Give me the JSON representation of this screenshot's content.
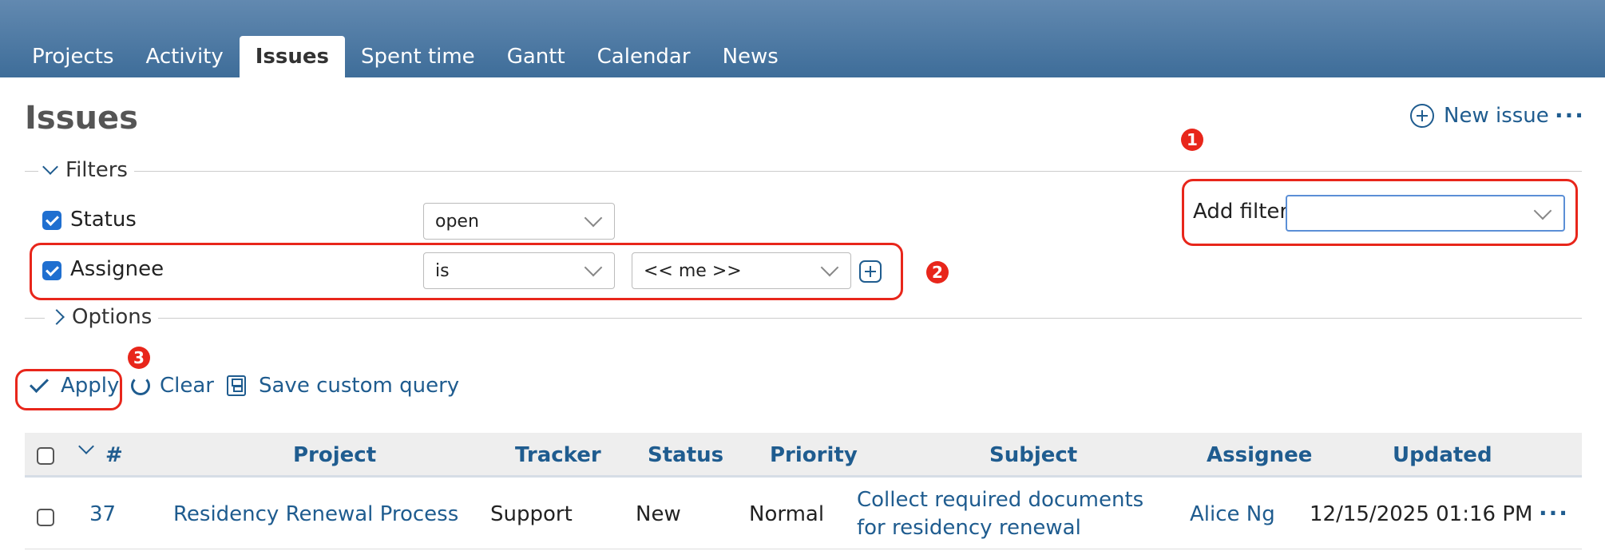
{
  "nav": {
    "tabs": [
      {
        "label": "Projects"
      },
      {
        "label": "Activity"
      },
      {
        "label": "Issues",
        "active": true
      },
      {
        "label": "Spent time"
      },
      {
        "label": "Gantt"
      },
      {
        "label": "Calendar"
      },
      {
        "label": "News"
      }
    ]
  },
  "header": {
    "title": "Issues",
    "new_issue": "New issue",
    "more": "···"
  },
  "filters": {
    "legend": "Filters",
    "status": {
      "label": "Status",
      "checked": true,
      "operator": "open"
    },
    "assignee": {
      "label": "Assignee",
      "checked": true,
      "operator": "is",
      "value": "<< me >>"
    },
    "add_filter": {
      "label": "Add filter",
      "value": ""
    }
  },
  "options": {
    "legend": "Options"
  },
  "annotations": {
    "one": "1",
    "two": "2",
    "three": "3"
  },
  "actions": {
    "apply": "Apply",
    "clear": "Clear",
    "save": "Save custom query"
  },
  "table": {
    "sort_toggle": "#",
    "columns": [
      "Project",
      "Tracker",
      "Status",
      "Priority",
      "Subject",
      "Assignee",
      "Updated"
    ],
    "rows": [
      {
        "id": "37",
        "project": "Residency Renewal Process",
        "tracker": "Support",
        "status": "New",
        "priority": "Normal",
        "subject_line1": "Collect required documents",
        "subject_line2": "for residency renewal",
        "assignee": "Alice Ng",
        "updated": "12/15/2025 01:16 PM",
        "more": "···"
      }
    ]
  },
  "colors": {
    "accent": "#1f5c8f",
    "highlight": "#e8261b",
    "header_bg": "#4f7ba5"
  }
}
